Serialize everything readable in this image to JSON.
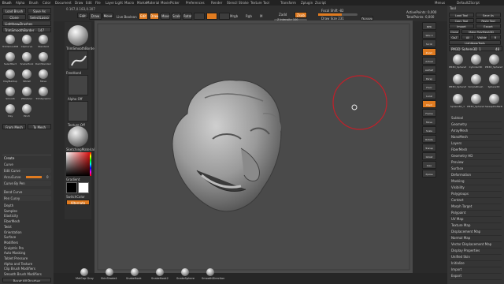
{
  "colors": {
    "accent": "#e07b20",
    "panel": "#353535",
    "canvas": "#4a4a4a",
    "brush_ring": "#c0202a"
  },
  "app": {
    "title": "Brush"
  },
  "top_menu": [
    "Alpha",
    "Brush",
    "Color",
    "Document",
    "Draw",
    "Edit",
    "File",
    "Layer",
    "Light",
    "Macro",
    "Marker",
    "Material",
    "Movie",
    "Picker",
    "Preferences",
    "Render",
    "Stencil",
    "Stroke",
    "Texture",
    "Tool",
    "Transform",
    "Zplugin",
    "Zscript"
  ],
  "top_menu_right": [
    "Menus",
    "DefaultZScript"
  ],
  "left_panel": {
    "title": "Brush",
    "buttons": [
      "Load Brush",
      "Save As",
      "Clone",
      "SelectLasso",
      "Lightbox▸Brushes"
    ],
    "slider": {
      "label": "TrimSmoothBorder",
      "value": "147"
    },
    "brush_names": [
      "TrimSmoothBorder",
      "ClipCurve",
      "Standard",
      "SelectRect",
      "SnakeHook",
      "DamStandard",
      "ClayBuildup",
      "hPolish",
      "Move",
      "Smooth",
      "ZModeler",
      "TrimDynamic",
      "Clay",
      "Pinch"
    ],
    "mesh_buttons": [
      "From Mesh",
      "To Mesh"
    ],
    "section_labels": [
      "Create",
      "Curve",
      "Edit Curve",
      "AccuCurve",
      "Curve By Pen",
      "Bend Curve",
      "Pen Curvy"
    ],
    "stroke_value": "0",
    "bottom_sections": [
      "Depth",
      "Samples",
      "Elasticity",
      "FiberMesh",
      "Twist",
      "Orientation",
      "Surface",
      "Modifiers",
      "Sculptris Pro",
      "Auto Masking",
      "Tablet Pressure",
      "Alpha and Texture",
      "Clip Brush Modifiers",
      "Smooth Brush Modifiers"
    ],
    "footer_button": "Reset All Brushes"
  },
  "shelf": {
    "items": [
      "TrimSmoothBorder",
      "FreeHand",
      "Alpha Off",
      "Texture Off",
      "SketchingMaterial",
      "Gradient",
      "SwitchColor",
      "Alternate"
    ]
  },
  "toolbar": {
    "mode_buttons": [
      "Edit",
      "Draw",
      "Move",
      "Scale",
      "Rotate"
    ],
    "center_label": "Live Boolean",
    "shape_buttons": [
      "Mrgb",
      "Rgb",
      "M"
    ],
    "zadd_label": "Zadd",
    "zsub_label": "Zsub",
    "z_intensity": "Z Intensity 100",
    "rgb_intensity": "Rgb Intensity 100",
    "focal_shift": "Focal Shift -82",
    "draw_size": "Draw Size 231",
    "dynamic_label": "Dynamic",
    "active_points": "ActivePoints: 0,000",
    "total_points": "TotalPoints: 0,000",
    "coords": "0.167,0.183,0.307"
  },
  "canvas": {
    "mesh": "head-sculpt",
    "brush_cursor": "draw-brush-ring"
  },
  "right_dock": {
    "buttons": [
      "BPR",
      "SPix 3",
      "Scroll",
      "Zoom",
      "Actual",
      "AAHalf",
      "Persp",
      "Floor",
      "Local",
      "LSym",
      "Frame",
      "Move",
      "Scale",
      "Rotate",
      "Transp",
      "Ghost",
      "Solo",
      "Xpose"
    ]
  },
  "right_panel": {
    "title": "Tool",
    "buttons": [
      "Load Tool",
      "Save As",
      "Copy Tool",
      "Paste Tool",
      "Import",
      "Export",
      "Clone",
      "Make PolyMesh3D",
      "GoZ",
      "All",
      "Visible",
      "R",
      "Lightbox▸Tools"
    ],
    "tool_slider": {
      "label": "PM3D_Sphere3D_1",
      "value": "48"
    },
    "tools": [
      "PM3D_Sphere3D",
      "Cylinder3D",
      "PM3D_Sphere3D",
      "PM3D_Sphere3D",
      "SimpleBrush",
      "Sphere3D",
      "Sphere3D_1",
      "PM3D_Sphere3D",
      "SweepProfile3D"
    ],
    "sections": [
      "Subtool",
      "Geometry",
      "ArrayMesh",
      "NanoMesh",
      "Layers",
      "FiberMesh",
      "Geometry HD",
      "Preview",
      "Surface",
      "Deformation",
      "Masking",
      "Visibility",
      "Polygroups",
      "Contact",
      "Morph Target",
      "Polypaint",
      "UV Map",
      "Texture Map",
      "Displacement Map",
      "Normal Map",
      "Vector Displacement Map",
      "Display Properties",
      "Unified Skin",
      "Initialize",
      "Import",
      "Export"
    ]
  },
  "bottom_bar": {
    "materials": [
      "MatCap Gray",
      "SkinShade4",
      "SnakeHook",
      "SnakeHook2",
      "SnakeSphere",
      "SmoothDirection"
    ]
  }
}
